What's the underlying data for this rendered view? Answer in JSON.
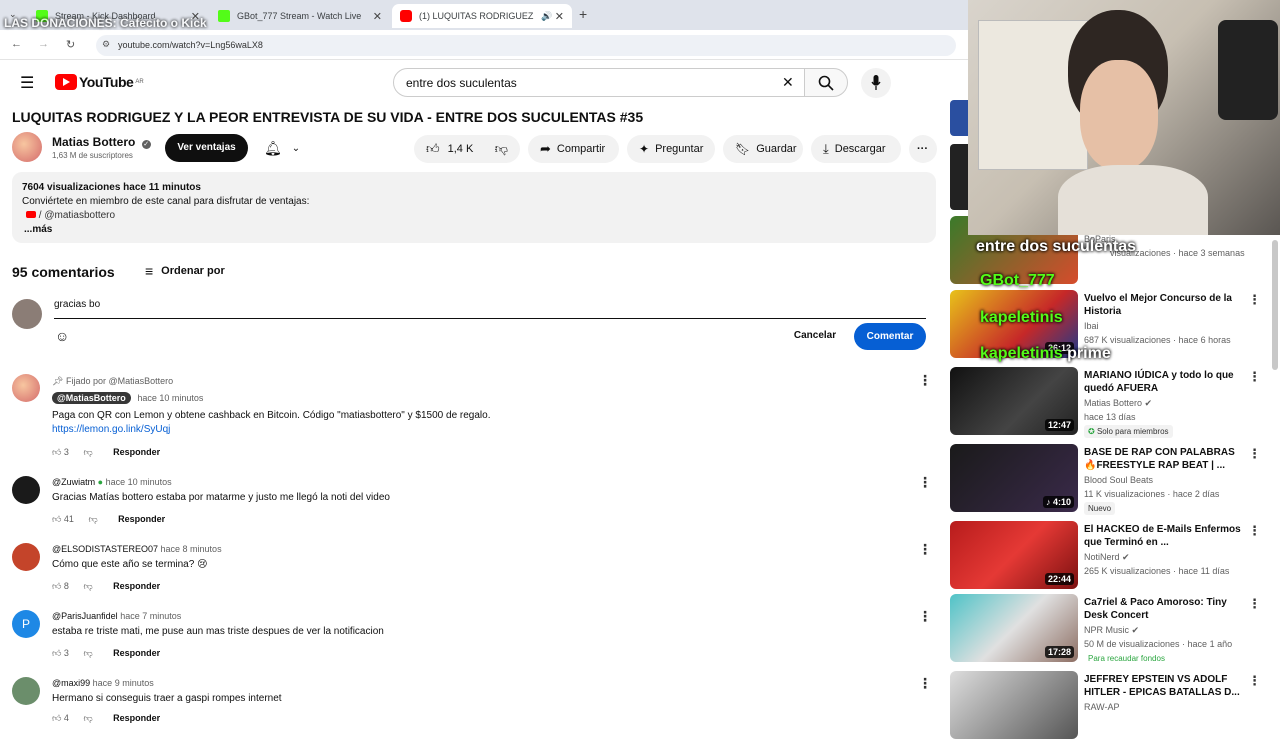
{
  "browser": {
    "tabs": [
      {
        "title": "Stream - Kick Dashboard"
      },
      {
        "title": "GBot_777 Stream - Watch Live"
      },
      {
        "title": "(1) LUQUITAS RODRIGUEZ"
      }
    ],
    "url": "youtube.com/watch?v=Lng56waLX8"
  },
  "youtube": {
    "logo": "YouTube",
    "country": "AR",
    "search_value": "entre dos suculentas"
  },
  "video": {
    "title": "LUQUITAS RODRIGUEZ Y LA PEOR ENTREVISTA DE SU VIDA - ENTRE DOS SUCULENTAS #35",
    "channel": "Matias Bottero",
    "subscribers": "1,63 M de suscriptores",
    "join_button": "Ver ventajas",
    "likes": "1,4 K",
    "share": "Compartir",
    "ask": "Preguntar",
    "save": "Guardar",
    "download": "Descargar",
    "description": {
      "stats": "7604 visualizaciones  hace 11 minutos",
      "line1": "Conviértete en miembro de este canal para disfrutar de ventajas:",
      "link": "/ @matiasbottero",
      "more": "...más"
    }
  },
  "comments": {
    "count_label": "95 comentarios",
    "sort_label": "Ordenar por",
    "draft": "gracias bo",
    "cancel": "Cancelar",
    "submit": "Comentar",
    "items": [
      {
        "pinned": "Fijado por @MatiasBottero",
        "author": "@MatiasBottero",
        "time": "hace 10 minutos",
        "text": "Paga con QR con Lemon y obtene cashback en Bitcoin. Código \"matiasbottero\" y $1500 de regalo.",
        "link": "https://lemon.go.link/SyUqj",
        "likes": "3",
        "reply": "Responder"
      },
      {
        "author": "@Zuwiatm",
        "time": "hace 10 minutos",
        "text": "Gracias Matías bottero estaba por matarme y justo me llegó la noti del video",
        "likes": "41",
        "reply": "Responder"
      },
      {
        "author": "@ELSODISTASTEREO07",
        "time": "hace 8 minutos",
        "text": "Cómo que este año se termina? 😢",
        "likes": "8",
        "reply": "Responder"
      },
      {
        "author": "@ParisJuanfidel",
        "time": "hace 7 minutos",
        "text": "estaba re triste mati, me puse aun mas triste despues de ver la notificacion",
        "likes": "3",
        "reply": "Responder",
        "initial": "P"
      },
      {
        "author": "@maxi99",
        "time": "hace 9 minutos",
        "text": "Hermano si conseguis traer a gaspi rompes internet",
        "likes": "4",
        "reply": "Responder"
      }
    ]
  },
  "sidebar": {
    "items": [
      {
        "title": "",
        "channel": "BoParis",
        "meta": "visualizaciones · hace 3 semanas",
        "duration": ""
      },
      {
        "title": "Vuelvo el Mejor Concurso de la Historia",
        "channel": "Ibai",
        "meta": "687 K visualizaciones · hace 6 horas",
        "duration": "26:12"
      },
      {
        "title": "MARIANO IÚDICA y todo lo que quedó AFUERA",
        "channel": "Matias Bottero",
        "meta": "hace 13 días",
        "badge": "Solo para miembros",
        "duration": "12:47"
      },
      {
        "title": "BASE DE RAP CON PALABRAS 🔥FREESTYLE RAP BEAT | ...",
        "channel": "Blood Soul Beats",
        "meta": "11 K visualizaciones · hace 2 días",
        "badge": "Nuevo",
        "duration": "4:10"
      },
      {
        "title": "El HACKEO de E-Mails Enfermos que Terminó en ...",
        "channel": "NotiNerd",
        "meta": "265 K visualizaciones · hace 11 días",
        "duration": "22:44"
      },
      {
        "title": "Ca7riel & Paco Amoroso: Tiny Desk Concert",
        "channel": "NPR Music",
        "meta": "50 M de visualizaciones · hace 1 año",
        "badge": "Para recaudar fondos",
        "duration": "17:28"
      },
      {
        "title": "JEFFREY EPSTEIN VS ADOLF HITLER - EPICAS BATALLAS D...",
        "channel": "RAW-AP",
        "meta": "",
        "duration": ""
      }
    ]
  },
  "stream_overlay": {
    "top_text": "LAS DONACIONES: Cafecito o Kick",
    "title_text": "entre dos suculentas",
    "user1": "GBot_777",
    "user2": "kapeletinis",
    "user3": "kapeletinis",
    "prime": "prime"
  },
  "colors": {
    "accent": "#065fd4",
    "red": "#ff0000",
    "dark": "#0f0f0f",
    "green": "#2ba640"
  }
}
